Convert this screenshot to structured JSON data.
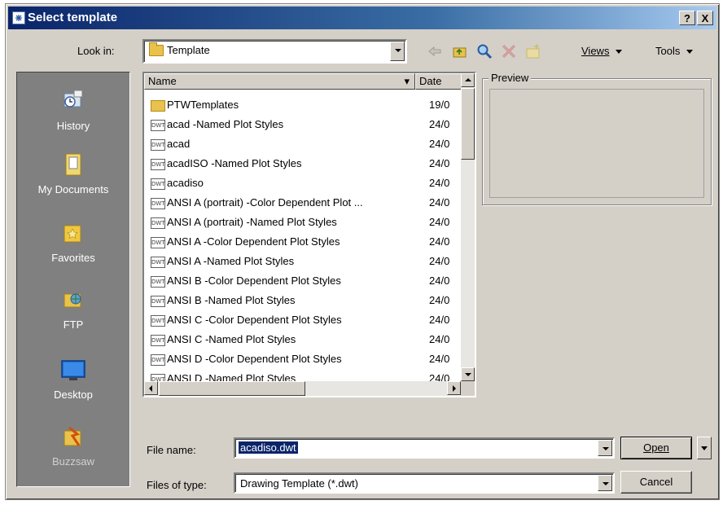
{
  "window": {
    "title": "Select template",
    "help_label": "?",
    "close_label": "X"
  },
  "lookin": {
    "label": "Look in:",
    "value": "Template"
  },
  "toolbar": {
    "icons": [
      "back-icon",
      "up-folder-icon",
      "search-web-icon",
      "delete-icon",
      "create-folder-icon"
    ],
    "views_label": "Views",
    "tools_label": "Tools"
  },
  "places": [
    {
      "label": "History",
      "icon": "history-icon"
    },
    {
      "label": "My Documents",
      "icon": "my-documents-icon"
    },
    {
      "label": "Favorites",
      "icon": "favorites-icon"
    },
    {
      "label": "FTP",
      "icon": "ftp-icon"
    },
    {
      "label": "Desktop",
      "icon": "desktop-icon"
    },
    {
      "label": "Buzzsaw",
      "icon": "buzzsaw-icon"
    }
  ],
  "filelist": {
    "columns": {
      "name": "Name",
      "date": "Date"
    },
    "files": [
      {
        "name": "PTWTemplates",
        "date": "19/0",
        "type": "folder"
      },
      {
        "name": "acad -Named Plot Styles",
        "date": "24/0",
        "type": "dwt"
      },
      {
        "name": "acad",
        "date": "24/0",
        "type": "dwt"
      },
      {
        "name": "acadISO -Named Plot Styles",
        "date": "24/0",
        "type": "dwt"
      },
      {
        "name": "acadiso",
        "date": "24/0",
        "type": "dwt"
      },
      {
        "name": "ANSI A (portrait) -Color Dependent Plot ...",
        "date": "24/0",
        "type": "dwt"
      },
      {
        "name": "ANSI A (portrait) -Named Plot Styles",
        "date": "24/0",
        "type": "dwt"
      },
      {
        "name": "ANSI A -Color Dependent Plot Styles",
        "date": "24/0",
        "type": "dwt"
      },
      {
        "name": "ANSI A -Named Plot Styles",
        "date": "24/0",
        "type": "dwt"
      },
      {
        "name": "ANSI B -Color Dependent Plot Styles",
        "date": "24/0",
        "type": "dwt"
      },
      {
        "name": "ANSI B -Named Plot Styles",
        "date": "24/0",
        "type": "dwt"
      },
      {
        "name": "ANSI C -Color Dependent Plot Styles",
        "date": "24/0",
        "type": "dwt"
      },
      {
        "name": "ANSI C -Named Plot Styles",
        "date": "24/0",
        "type": "dwt"
      },
      {
        "name": "ANSI D -Color Dependent Plot Styles",
        "date": "24/0",
        "type": "dwt"
      },
      {
        "name": "ANSI D -Named Plot Styles",
        "date": "24/0",
        "type": "dwt"
      }
    ],
    "file_icon_text": "DWT"
  },
  "preview": {
    "label": "Preview"
  },
  "file_name": {
    "label": "File name:",
    "value": "acadiso.dwt"
  },
  "file_type": {
    "label": "Files of type:",
    "value": "Drawing Template (*.dwt)"
  },
  "buttons": {
    "open": "Open",
    "cancel": "Cancel"
  }
}
